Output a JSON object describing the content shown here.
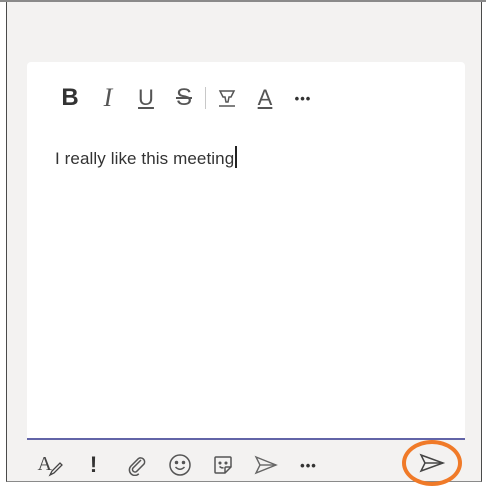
{
  "compose": {
    "message_text": "I really like this meeting"
  },
  "format_toolbar": {
    "bold_label": "B",
    "italic_label": "I",
    "underline_label": "U",
    "strike_label": "S",
    "font_color_label": "A",
    "more_label": "•••"
  },
  "bottom_toolbar": {
    "format_label": "A",
    "important_label": "!",
    "more_label": "•••"
  },
  "colors": {
    "accent": "#6264a7",
    "send_highlight": "#f07a28",
    "panel_background": "#f3f2f1"
  }
}
